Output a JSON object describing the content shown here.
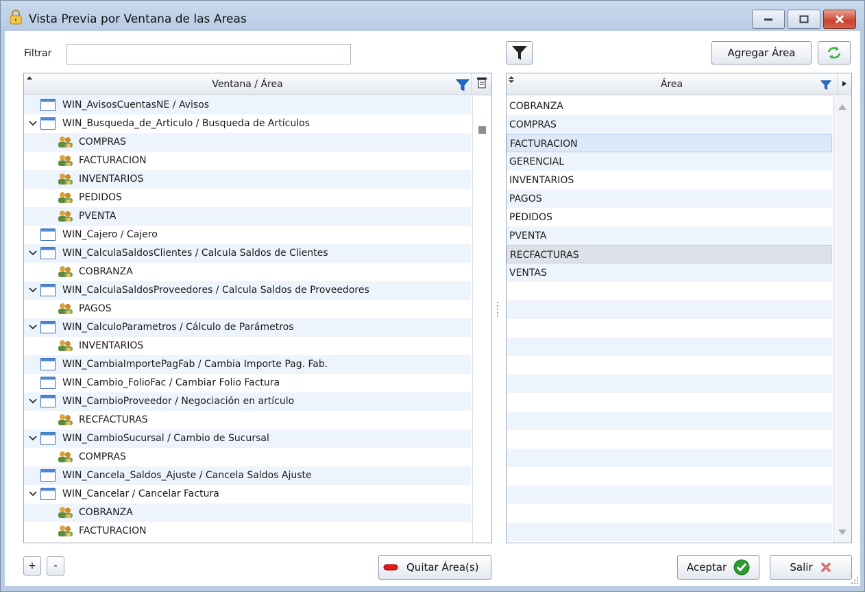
{
  "window": {
    "title": "Vista Previa por Ventana de las Areas"
  },
  "filter": {
    "label": "Filtrar",
    "value": "",
    "placeholder": ""
  },
  "toolbar": {
    "filter_toggle_icon": "funnel-icon",
    "add_area_label": "Agregar Área",
    "refresh_icon": "green-refresh-arrows-icon"
  },
  "left_grid": {
    "header": "Ventana / Área",
    "rows": [
      {
        "kind": "window",
        "expanded": false,
        "text": "WIN_AvisosCuentasNE / Avisos"
      },
      {
        "kind": "window",
        "expanded": true,
        "text": "WIN_Busqueda_de_Articulo / Busqueda de Artículos"
      },
      {
        "kind": "area",
        "text": "COMPRAS"
      },
      {
        "kind": "area",
        "text": "FACTURACION"
      },
      {
        "kind": "area",
        "text": "INVENTARIOS"
      },
      {
        "kind": "area",
        "text": "PEDIDOS"
      },
      {
        "kind": "area",
        "text": "PVENTA"
      },
      {
        "kind": "window",
        "expanded": false,
        "text": "WIN_Cajero / Cajero"
      },
      {
        "kind": "window",
        "expanded": true,
        "text": "WIN_CalculaSaldosClientes / Calcula Saldos de Clientes"
      },
      {
        "kind": "area",
        "text": "COBRANZA"
      },
      {
        "kind": "window",
        "expanded": true,
        "text": "WIN_CalculaSaldosProveedores / Calcula Saldos de Proveedores"
      },
      {
        "kind": "area",
        "text": "PAGOS"
      },
      {
        "kind": "window",
        "expanded": true,
        "text": "WIN_CalculoParametros / Cálculo de Parámetros"
      },
      {
        "kind": "area",
        "text": "INVENTARIOS"
      },
      {
        "kind": "window",
        "expanded": false,
        "text": "WIN_CambiaImportePagFab / Cambia Importe Pag. Fab."
      },
      {
        "kind": "window",
        "expanded": false,
        "text": "WIN_Cambio_FolioFac / Cambiar Folio Factura"
      },
      {
        "kind": "window",
        "expanded": true,
        "text": "WIN_CambioProveedor / Negociación en artículo"
      },
      {
        "kind": "area",
        "text": "RECFACTURAS"
      },
      {
        "kind": "window",
        "expanded": true,
        "text": "WIN_CambioSucursal / Cambio de Sucursal"
      },
      {
        "kind": "area",
        "text": "COMPRAS"
      },
      {
        "kind": "window",
        "expanded": false,
        "text": "WIN_Cancela_Saldos_Ajuste / Cancela Saldos Ajuste"
      },
      {
        "kind": "window",
        "expanded": true,
        "text": "WIN_Cancelar / Cancelar Factura"
      },
      {
        "kind": "area",
        "text": "COBRANZA"
      },
      {
        "kind": "area",
        "text": "FACTURACION"
      }
    ]
  },
  "right_grid": {
    "header": "Área",
    "rows": [
      {
        "text": "COBRANZA",
        "state": "normal"
      },
      {
        "text": "COMPRAS",
        "state": "normal"
      },
      {
        "text": "FACTURACION",
        "state": "selected"
      },
      {
        "text": "GERENCIAL",
        "state": "normal"
      },
      {
        "text": "INVENTARIOS",
        "state": "normal"
      },
      {
        "text": "PAGOS",
        "state": "normal"
      },
      {
        "text": "PEDIDOS",
        "state": "normal"
      },
      {
        "text": "PVENTA",
        "state": "normal"
      },
      {
        "text": "RECFACTURAS",
        "state": "hover"
      },
      {
        "text": "VENTAS",
        "state": "normal"
      }
    ],
    "empty_rows": 14
  },
  "bottom": {
    "expand_label": "+",
    "collapse_label": "-",
    "remove_area_label": "Quitar Área(s)",
    "accept_label": "Aceptar",
    "exit_label": "Salir"
  },
  "colors": {
    "row_alt": "#edf4fc",
    "title_bar": "#bccde3",
    "selected_row": "#dde9f8",
    "accept_green": "#2f9a2f",
    "exit_red": "#c83a3a",
    "remove_red": "#e01818"
  }
}
